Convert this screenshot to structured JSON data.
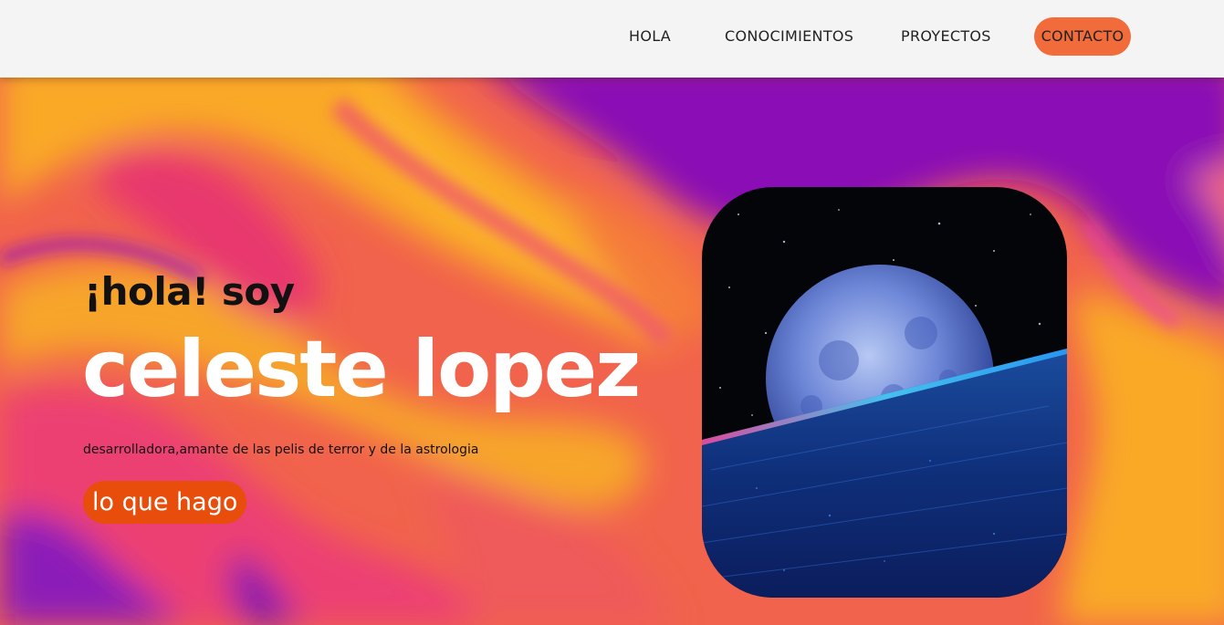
{
  "nav": {
    "items": [
      {
        "label": "HOLA"
      },
      {
        "label": "CONOCIMIENTOS"
      },
      {
        "label": "PROYECTOS"
      },
      {
        "label": "CONTACTO"
      }
    ]
  },
  "hero": {
    "greeting": "¡hola! soy",
    "name": "celeste lopez",
    "tagline": "desarrolladora,amante de las pelis de terror y de la astrologia",
    "cta_label": "lo que hago",
    "image_description_icon": "moon-ocean-image"
  },
  "colors": {
    "nav_background": "#f4f4f4",
    "contact_button": "#f26b3a",
    "cta_button": "#e84d0c",
    "hero_purple": "#8a08b5",
    "hero_orange": "#f9a928",
    "hero_pink": "#ec4a63",
    "name_text": "#ffffff"
  }
}
